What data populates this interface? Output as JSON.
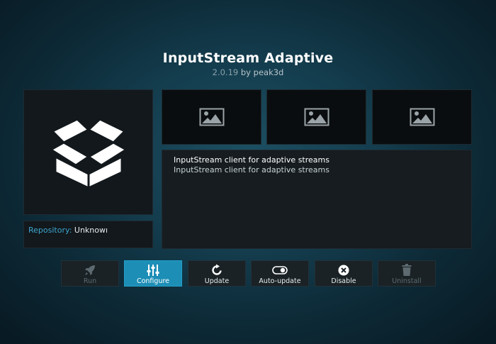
{
  "addon": {
    "name": "InputStream Adaptive",
    "version": "2.0.19",
    "by_label": "by",
    "author": "peak3d"
  },
  "icon": {
    "name": "package-box-icon"
  },
  "repository": {
    "label": "Repository:",
    "value": "Unknowı"
  },
  "screenshots": [
    {
      "icon": "image-placeholder-icon"
    },
    {
      "icon": "image-placeholder-icon"
    },
    {
      "icon": "image-placeholder-icon"
    }
  ],
  "description": {
    "summary": "InputStream client for adaptive streams",
    "body": "InputStream client for adaptive streams"
  },
  "buttons": [
    {
      "label": "Run",
      "icon": "rocket-icon",
      "state": "disabled"
    },
    {
      "label": "Configure",
      "icon": "sliders-icon",
      "state": "focused"
    },
    {
      "label": "Update",
      "icon": "refresh-icon",
      "state": "enabled"
    },
    {
      "label": "Auto-update",
      "icon": "toggle-icon",
      "state": "enabled"
    },
    {
      "label": "Disable",
      "icon": "close-circle-icon",
      "state": "enabled"
    },
    {
      "label": "Uninstall",
      "icon": "trash-icon",
      "state": "disabled"
    }
  ],
  "colors": {
    "accent": "#1d8eb6",
    "repository_label": "#3ea6cf",
    "panel": "#12181c"
  }
}
